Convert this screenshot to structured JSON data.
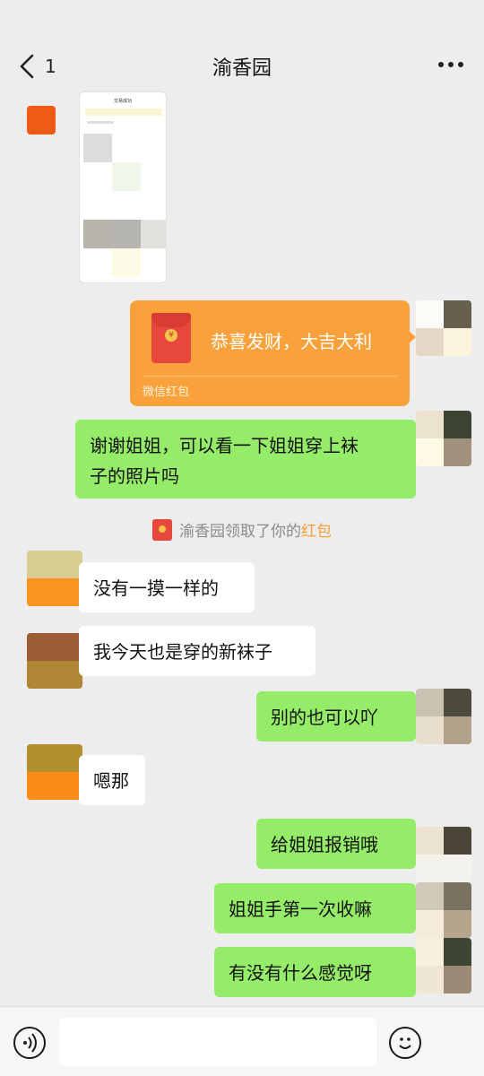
{
  "header": {
    "back_count": "1",
    "title": "渝香园"
  },
  "messages": {
    "red_packet": {
      "text": "恭喜发财，大吉大利",
      "label": "微信红包",
      "coin": "¥"
    },
    "m1": "谢谢姐姐，可以看一下姐姐穿上袜",
    "m1b": "子的照片吗",
    "system": {
      "prefix": "渝香园领取了你的",
      "link": "红包"
    },
    "m2": "没有一摸一样的",
    "m3": "我今天也是穿的新袜子",
    "m4": "别的也可以吖",
    "m5": "嗯那",
    "m6": "给姐姐报销哦",
    "m7": "姐姐手第一次收嘛",
    "m8": "有没有什么感觉呀"
  },
  "screenshot_thumb": {
    "title": "交易成功"
  },
  "input": {
    "placeholder": ""
  },
  "colors": {
    "bg": "#ededed",
    "outgoing_bubble": "#95ec69",
    "incoming_bubble": "#ffffff",
    "red_packet": "#f9a23b",
    "link": "#fa9d3b"
  }
}
